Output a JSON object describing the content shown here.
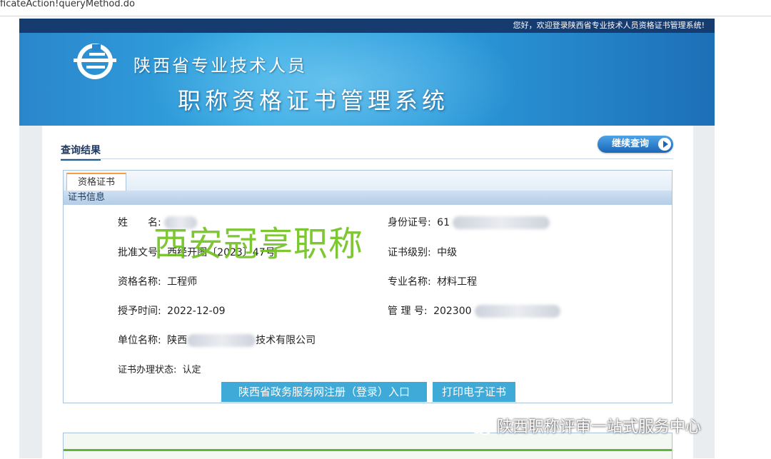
{
  "browser": {
    "url_fragment": "ficateAction!queryMethod.do"
  },
  "header": {
    "welcome": "您好，欢迎登录陕西省专业技术人员资格证书管理系统!",
    "title_line1": "陕西省专业技术人员",
    "title_line2": "职称资格证书管理系统"
  },
  "result": {
    "section_title": "查询结果",
    "continue_button": "继续查询",
    "tab": "资格证书",
    "info_header": "证书信息",
    "fields": {
      "name": {
        "label": "姓　　名:",
        "value": ""
      },
      "id_no": {
        "label": "身份证号:",
        "value": "61"
      },
      "approval_no": {
        "label": "批准文号:",
        "value": "西经开图〔2023〕47号"
      },
      "level": {
        "label": "证书级别:",
        "value": "中级"
      },
      "qualification": {
        "label": "资格名称:",
        "value": "工程师"
      },
      "specialty": {
        "label": "专业名称:",
        "value": "材料工程"
      },
      "grant_date": {
        "label": "授予时间:",
        "value": "2022-12-09"
      },
      "mgmt_no": {
        "label": "管 理 号:",
        "value": "202300"
      },
      "employer": {
        "label": "单位名称:",
        "value_prefix": "陕西",
        "value_suffix": "技术有限公司"
      },
      "status": {
        "label": "证书办理状态:",
        "value": "认定"
      }
    },
    "buttons": {
      "gov_register": "陕西省政务服务网注册（登录）入口",
      "print_cert": "打印电子证书"
    }
  },
  "overlay": {
    "watermark": "西安冠享职称",
    "wechat_source": "陕西职称评审一站式服务中心"
  },
  "colors": {
    "banner": "#2c9bdb",
    "banner_top": "#163b6e",
    "action_button": "#3fa9d8",
    "watermark": "#6fc11e"
  }
}
